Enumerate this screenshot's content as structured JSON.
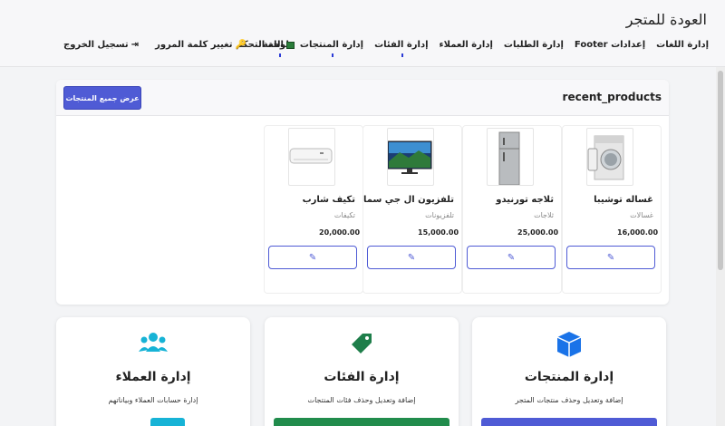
{
  "header": {
    "store_title": "العودة للمتجر",
    "nav": [
      "لوحة التحكم",
      "إدارة المنتجات",
      "إدارة الفئات",
      "إدارة العملاء",
      "إدارة الطلبات",
      "إعدادات Footer",
      "إدارة اللغات"
    ],
    "language": "اللغة",
    "change_password": "تغيير كلمة المرور",
    "logout": "تسجيل الخروج"
  },
  "recent": {
    "title": "recent_products",
    "view_all": "عرض جميع المنتجات",
    "products": [
      {
        "name": "غساله توشيبا",
        "category": "غسالات",
        "price": "16,000.00",
        "image": "washing-machine"
      },
      {
        "name": "ثلاجه تورنيدو",
        "category": "ثلاجات",
        "price": "25,000.00",
        "image": "refrigerator"
      },
      {
        "name": "تلفزيون ال جي سمارت",
        "category": "تلفزيونات",
        "price": "15,000.00",
        "image": "television"
      },
      {
        "name": "تكيف شارب",
        "category": "تكيفات",
        "price": "20,000.00",
        "image": "air-conditioner"
      }
    ]
  },
  "cards": [
    {
      "title": "إدارة المنتجات",
      "desc": "إضافة وتعديل وحذف منتجات المتجر",
      "icon": "box-icon",
      "color": "#1a73e8",
      "button_color": "#4f5bd5"
    },
    {
      "title": "إدارة الفئات",
      "desc": "إضافة وتعديل وحذف فئات المنتجات",
      "icon": "tag-icon",
      "color": "#1e7e4a",
      "button_color": "#218c4c"
    },
    {
      "title": "إدارة العملاء",
      "desc": "إدارة حسابات العملاء وبياناتهم",
      "icon": "users-icon",
      "color": "#17b3d6",
      "button_color": "#17b3d6"
    }
  ]
}
